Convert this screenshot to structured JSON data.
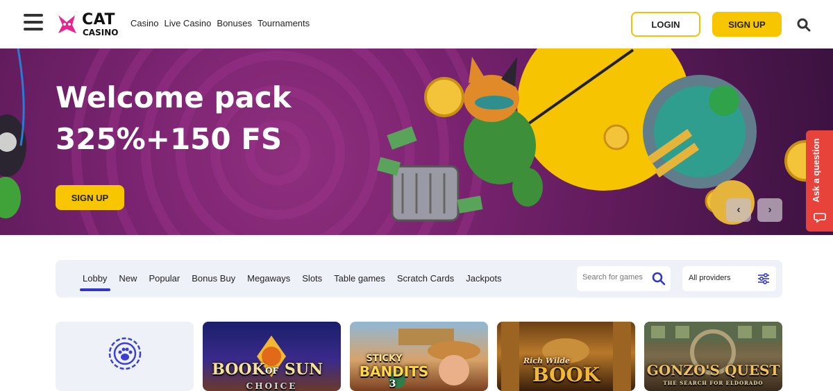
{
  "header": {
    "logo_main": "CAT",
    "logo_sub": "CASINO",
    "nav": [
      "Casino",
      "Live Casino",
      "Bonuses",
      "Tournaments"
    ],
    "login_label": "LOGIN",
    "signup_label": "SIGN UP"
  },
  "banner": {
    "title_line1": "Welcome pack",
    "title_line2": "325%+150 FS",
    "cta_label": "SIGN UP",
    "ask_label": "Ask a question"
  },
  "filters": {
    "tabs": [
      "Lobby",
      "New",
      "Popular",
      "Bonus Buy",
      "Megaways",
      "Slots",
      "Table games",
      "Scratch Cards",
      "Jackpots"
    ],
    "active_tab": "Lobby",
    "search_placeholder": "Search for games",
    "providers_label": "All providers"
  },
  "games": [
    {
      "title_a": "BOOK",
      "title_b": "OF",
      "title_c": "SUN",
      "sub": "CHOICE"
    },
    {
      "title_a": "STICKY",
      "title_b": "BANDITS",
      "sub": "3"
    },
    {
      "title_a": "Rich Wilde",
      "title_b": "BOOK"
    },
    {
      "title_a": "GONZO'S QUEST",
      "sub": "THE SEARCH FOR ELDORADO"
    }
  ],
  "colors": {
    "accent_yellow": "#f7c600",
    "tab_active": "#2f35c9",
    "ask_red": "#e8433a",
    "banner_purple": "#7a2370"
  }
}
